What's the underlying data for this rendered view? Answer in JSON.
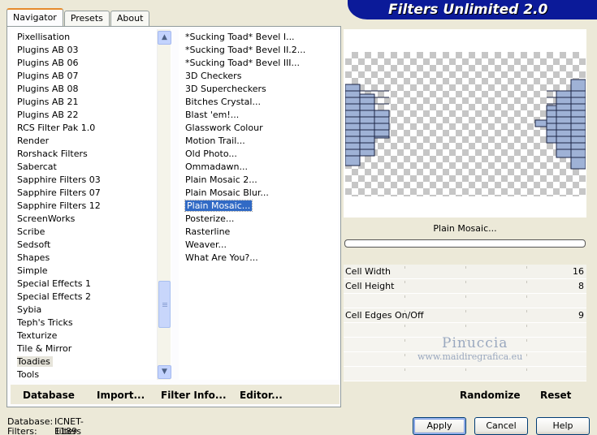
{
  "tabs": [
    {
      "label": "Navigator",
      "active": true
    },
    {
      "label": "Presets",
      "active": false
    },
    {
      "label": "About",
      "active": false
    }
  ],
  "title": "Filters Unlimited 2.0",
  "categories": [
    "Pixellisation",
    "Plugins AB 03",
    "Plugins AB 06",
    "Plugins AB 07",
    "Plugins AB 08",
    "Plugins AB 21",
    "Plugins AB 22",
    "RCS Filter Pak 1.0",
    "Render",
    "Rorshack Filters",
    "Sabercat",
    "Sapphire Filters 03",
    "Sapphire Filters 07",
    "Sapphire Filters 12",
    "ScreenWorks",
    "Scribe",
    "Sedsoft",
    "Shapes",
    "Simple",
    "Special Effects 1",
    "Special Effects 2",
    "Sybia",
    "Teph's Tricks",
    "Texturize",
    "Tile & Mirror",
    "Toadies",
    "Tools"
  ],
  "selected_category": "Toadies",
  "filters": [
    "*Sucking Toad*  Bevel I...",
    "*Sucking Toad*  Bevel II.2...",
    "*Sucking Toad*  Bevel III...",
    "3D Checkers",
    "3D Supercheckers",
    "Bitches Crystal...",
    "Blast 'em!...",
    "Glasswork Colour",
    "Motion Trail...",
    "Old Photo...",
    "Ommadawn...",
    "Plain Mosaic 2...",
    "Plain Mosaic Blur...",
    "Plain Mosaic...",
    "Posterize...",
    "Rasterline",
    "Weaver...",
    "What Are You?..."
  ],
  "selected_filter": "Plain Mosaic...",
  "preview": {
    "filter_name": "Plain Mosaic...",
    "progress": 0
  },
  "params": [
    {
      "label": "Cell Width",
      "value": "16"
    },
    {
      "label": "Cell Height",
      "value": "8"
    },
    {
      "label": "",
      "value": ""
    },
    {
      "label": "Cell Edges On/Off",
      "value": "9"
    },
    {
      "label": "",
      "value": ""
    },
    {
      "label": "",
      "value": ""
    },
    {
      "label": "",
      "value": ""
    },
    {
      "label": "",
      "value": ""
    }
  ],
  "bottom_left": {
    "database": "Database",
    "import": "Import...",
    "filter_info": "Filter Info...",
    "editor": "Editor..."
  },
  "bottom_right": {
    "randomize": "Randomize",
    "reset": "Reset"
  },
  "watermark": {
    "line1": "Pinuccia",
    "line2": "www.maidiregrafica.eu"
  },
  "status": {
    "database_label": "Database:",
    "database_value": "ICNET-Filters",
    "filters_label": "Filters:",
    "filters_value": "1189"
  },
  "buttons": {
    "apply": "Apply",
    "cancel": "Cancel",
    "help": "Help"
  }
}
